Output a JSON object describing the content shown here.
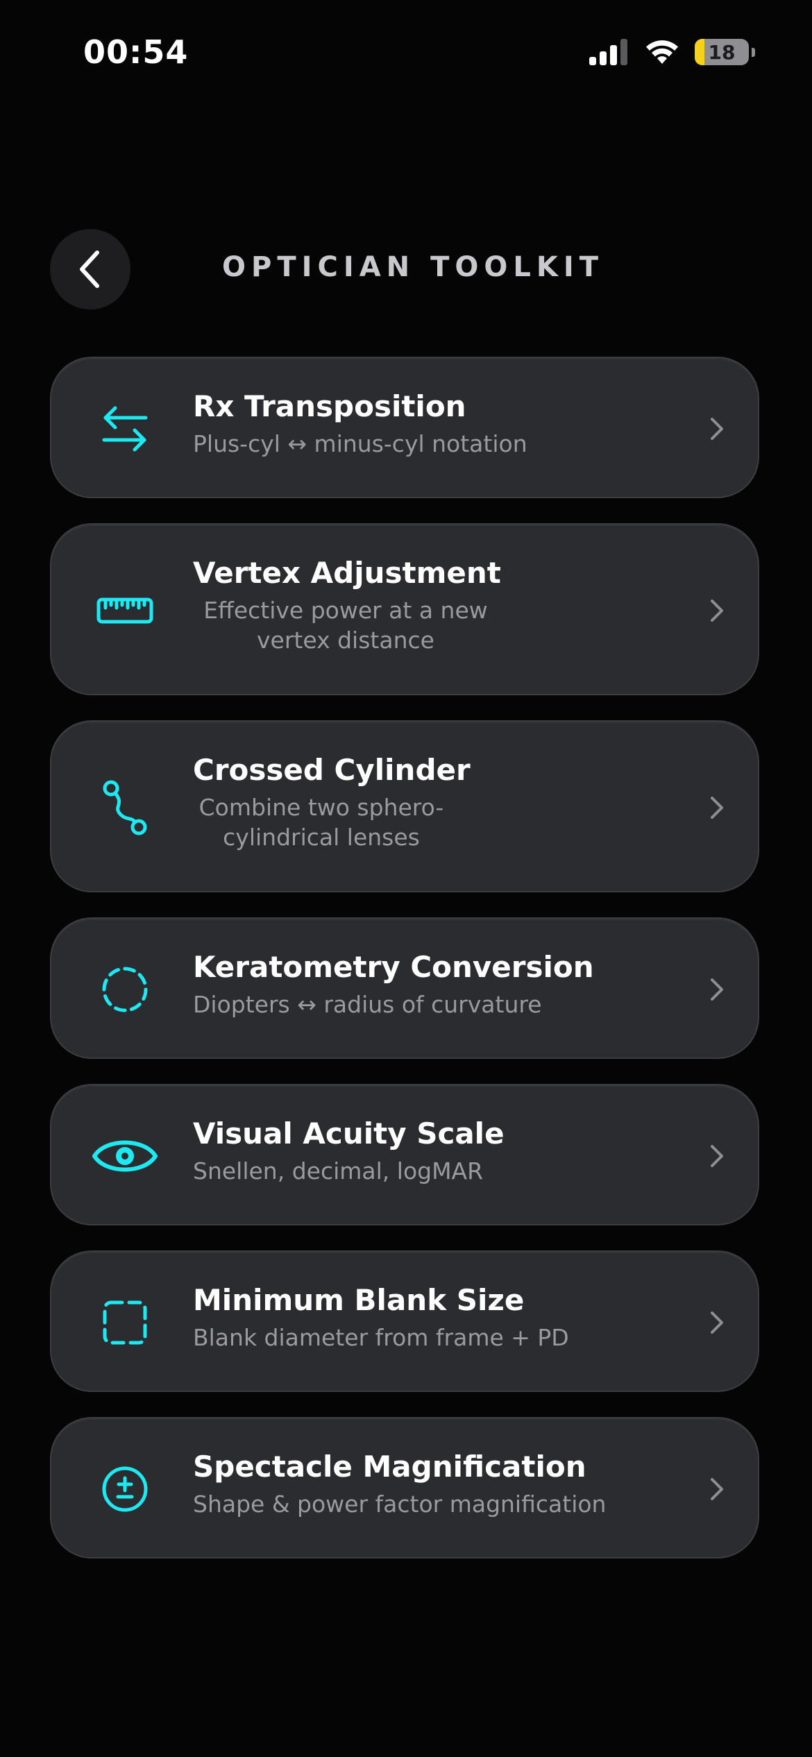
{
  "status_bar": {
    "time": "00:54",
    "battery_level": "18",
    "battery_fraction": 0.18,
    "battery_color": "#f5d11a",
    "icons": [
      "cellular-signal-icon",
      "wifi-icon",
      "battery-icon"
    ]
  },
  "header": {
    "back_icon": "chevron-left-icon",
    "title": "OPTICIAN TOOLKIT"
  },
  "accent_color": "#1de9f3",
  "tools": [
    {
      "icon": "swap-arrows-icon",
      "title": "Rx Transposition",
      "subtitle": "Plus-cyl ↔ minus-cyl notation"
    },
    {
      "icon": "ruler-icon",
      "title": "Vertex Adjustment",
      "subtitle": "Effective power at a new vertex distance"
    },
    {
      "icon": "route-icon",
      "title": "Crossed Cylinder",
      "subtitle": "Combine two sphero-cylindrical lenses"
    },
    {
      "icon": "dashed-circle-icon",
      "title": "Keratometry Conversion",
      "subtitle": "Diopters ↔ radius of curvature"
    },
    {
      "icon": "eye-icon",
      "title": "Visual Acuity Scale",
      "subtitle": "Snellen, decimal, logMAR"
    },
    {
      "icon": "dashed-square-icon",
      "title": "Minimum Blank Size",
      "subtitle": "Blank diameter from frame + PD"
    },
    {
      "icon": "plus-minus-circle-icon",
      "title": "Spectacle Magnification",
      "subtitle": "Shape & power factor magnification"
    }
  ]
}
